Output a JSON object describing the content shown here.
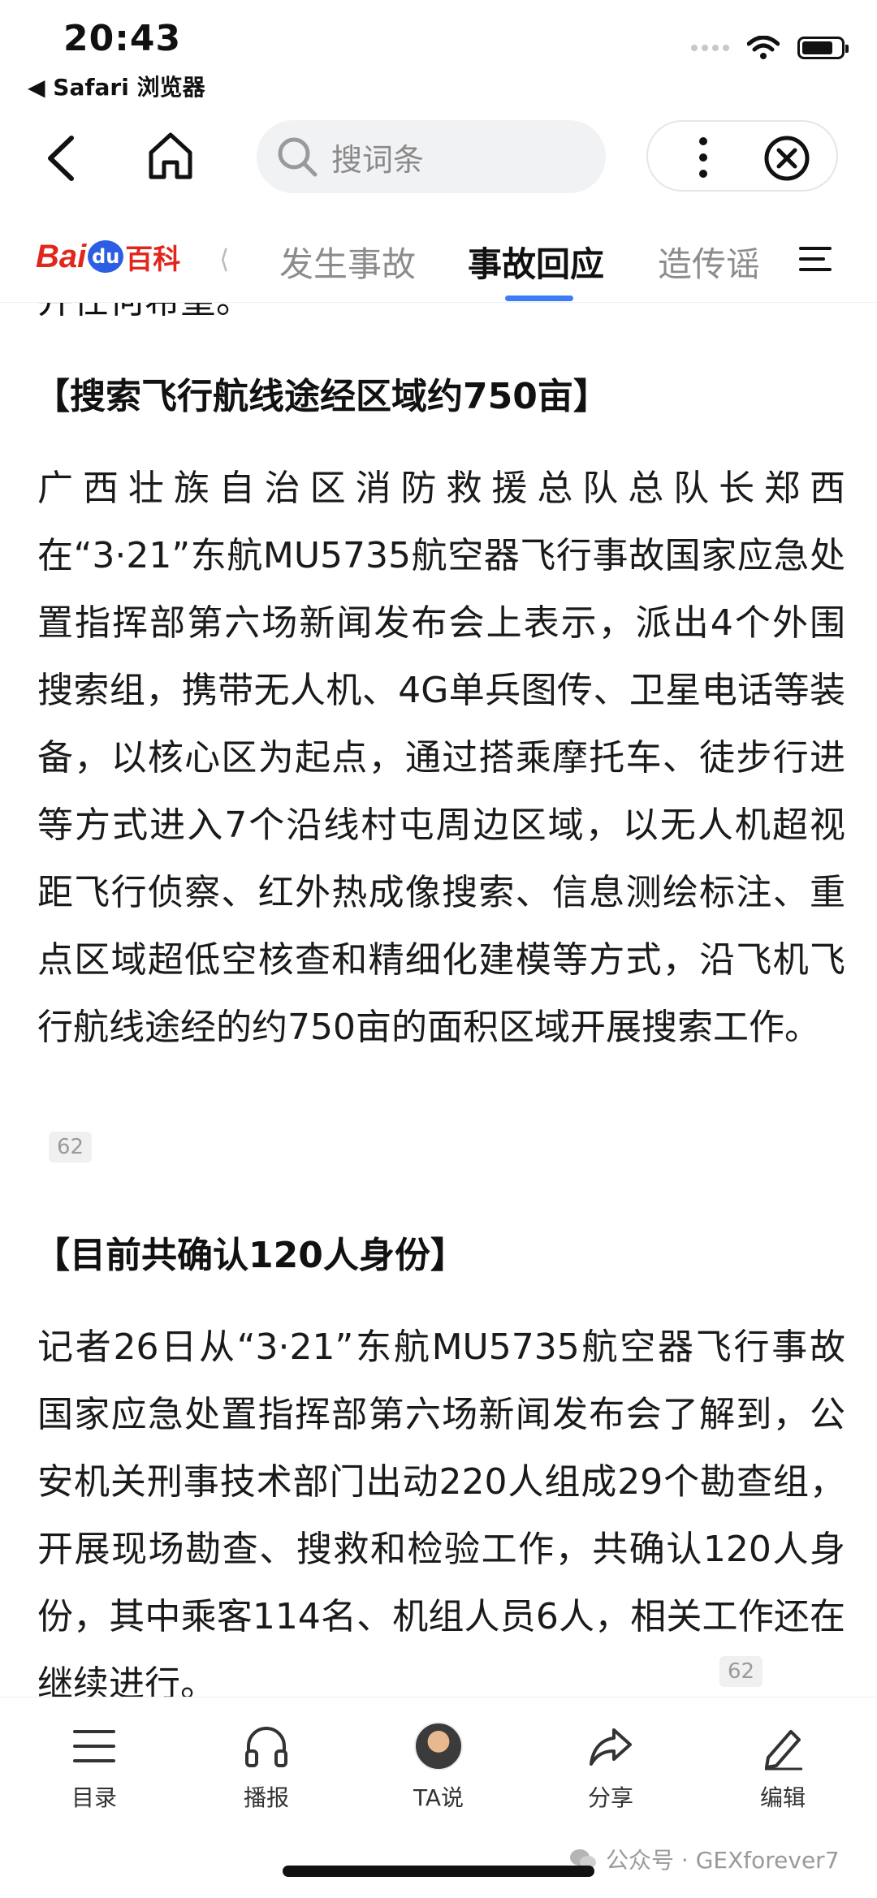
{
  "status": {
    "time": "20:43",
    "back_app": "◀ Safari 浏览器"
  },
  "search": {
    "placeholder": "搜词条"
  },
  "tabs": [
    {
      "label": "发生事故",
      "active": false
    },
    {
      "label": "事故回应",
      "active": true
    },
    {
      "label": "造传谣",
      "active": false
    }
  ],
  "logo": {
    "bai": "Bai",
    "du": "du",
    "baike": "百科"
  },
  "article": {
    "partial_top": "并任何希望。",
    "section1": {
      "heading": "【搜索飞行航线途经区域约750亩】",
      "body": "广西壮族自治区消防救援总队总队长郑西在“3·21”东航MU5735航空器飞行事故国家应急处置指挥部第六场新闻发布会上表示，派出4个外围搜索组，携带无人机、4G单兵图传、卫星电话等装备，以核心区为起点，通过搭乘摩托车、徒步行进等方式进入7个沿线村屯周边区域，以无人机超视距飞行侦察、红外热成像搜索、信息测绘标注、重点区域超低空核查和精细化建模等方式，沿飞机飞行航线途经的约750亩的面积区域开展搜索工作。",
      "citation": "62"
    },
    "section2": {
      "heading": "【目前共确认120人身份】",
      "body": "记者26日从“3·21”东航MU5735航空器飞行事故国家应急处置指挥部第六场新闻发布会了解到，公安机关刑事技术部门出动220人组成29个勘查组，开展现场勘查、搜救和检验工作，共确认120人身份，其中乘客114名、机组人员6人，相关工作还在继续进行。",
      "citation": "62"
    }
  },
  "toolbar": {
    "catalog": "目录",
    "broadcast": "播报",
    "ta_say": "TA说",
    "share": "分享",
    "edit": "编辑"
  },
  "watermark": "公众号 · GEXforever7",
  "colors": {
    "accent": "#3d7bf7",
    "baidu_red": "#e1261c",
    "baidu_blue": "#2b5ee3"
  }
}
